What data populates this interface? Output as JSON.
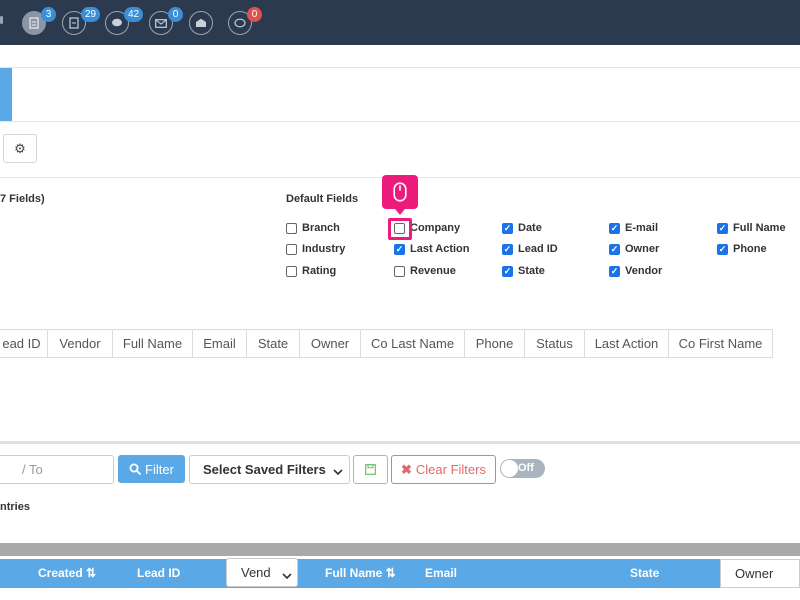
{
  "topbar": {
    "badges": [
      "3",
      "29",
      "42",
      "0",
      "0"
    ],
    "red_badge": "0",
    "icons": [
      "report-icon",
      "document-icon",
      "chat-icon",
      "mail-icon",
      "mail-open-icon",
      "comment-icon"
    ]
  },
  "fields": {
    "left_title": "7 Fields)",
    "default_title": "Default Fields",
    "items": [
      {
        "label": "Branch",
        "checked": false
      },
      {
        "label": "Industry",
        "checked": false
      },
      {
        "label": "Rating",
        "checked": false
      },
      {
        "label": "Company",
        "checked": false
      },
      {
        "label": "Last Action",
        "checked": true
      },
      {
        "label": "Revenue",
        "checked": false
      },
      {
        "label": "Date",
        "checked": true
      },
      {
        "label": "Lead ID",
        "checked": true
      },
      {
        "label": "State",
        "checked": true
      },
      {
        "label": "E-mail",
        "checked": true
      },
      {
        "label": "Owner",
        "checked": true
      },
      {
        "label": "Vendor",
        "checked": true
      },
      {
        "label": "Full Name",
        "checked": true
      },
      {
        "label": "Phone",
        "checked": true
      }
    ]
  },
  "columns": [
    "ead ID",
    "Vendor",
    "Full Name",
    "Email",
    "State",
    "Owner",
    "Co Last Name",
    "Phone",
    "Status",
    "Last Action",
    "Co First Name"
  ],
  "filters": {
    "to_placeholder": "/ To",
    "filter_label": "Filter",
    "saved_filters": "Select Saved Filters",
    "clear_label": "Clear Filters",
    "toggle_label": "Off",
    "entries_text": "ntries"
  },
  "table": {
    "headers": {
      "created": "Created ⇅",
      "lead_id": "Lead ID",
      "vend": "Vend",
      "full_name": "Full Name ⇅",
      "email": "Email",
      "state": "State",
      "owner": "Owner"
    }
  },
  "colors": {
    "topbar": "#2b3a4e",
    "accent": "#5aa9e6",
    "highlight": "#ee1b7f",
    "checkbox": "#1a73e8"
  }
}
